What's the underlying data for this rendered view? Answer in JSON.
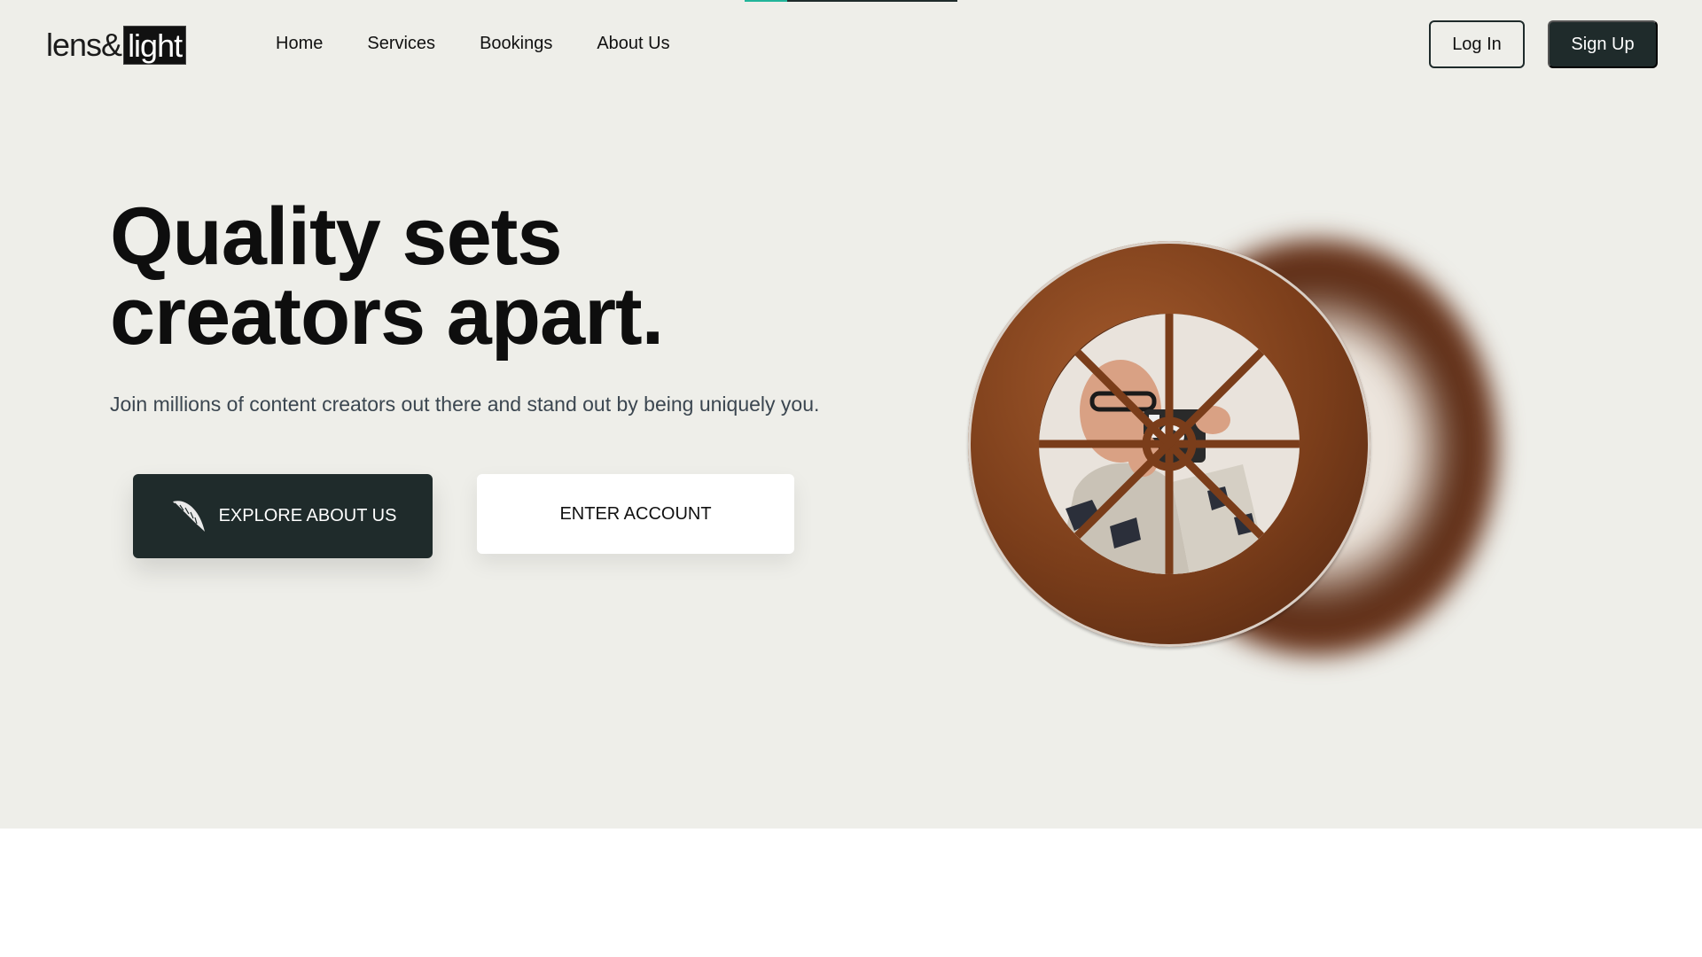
{
  "brand": {
    "logo_part1": "lens&",
    "logo_part2": "light"
  },
  "nav": {
    "items": [
      "Home",
      "Services",
      "Bookings",
      "About Us"
    ]
  },
  "header": {
    "login_label": "Log In",
    "signup_label": "Sign Up"
  },
  "hero": {
    "headline_line1": "Quality sets",
    "headline_line2": "creators apart.",
    "subtext": "Join millions of content creators out there and stand out by being uniquely you.",
    "explore_label": "EXPLORE ABOUT US",
    "enter_label": "ENTER ACCOUNT"
  },
  "icons": {
    "explore_icon": "feather-icon"
  },
  "colors": {
    "primary": "#1f2b2b",
    "accent": "#22b59a",
    "hero_bg": "#eeeee9"
  }
}
